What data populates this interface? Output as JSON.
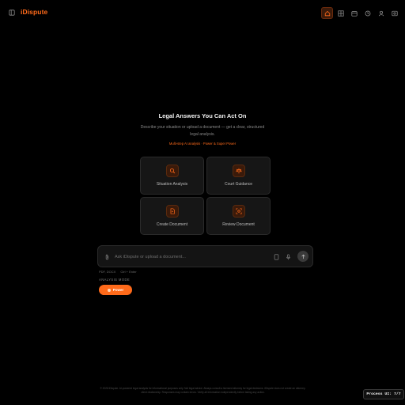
{
  "app": {
    "brand": "iDispute"
  },
  "nav": {
    "items": [
      "home-icon",
      "grid-icon",
      "calendar-icon",
      "clock-icon",
      "user-icon",
      "settings-icon"
    ],
    "active": "home-icon"
  },
  "hero": {
    "title": "Legal Answers You Can Act On",
    "subtitle": "Describe your situation or upload a document — get a clear, structured legal analysis.",
    "tagline": "Multi-step AI analysis · Power & Super Power"
  },
  "cards": [
    {
      "label": "Situation Analysis",
      "icon": "search-icon"
    },
    {
      "label": "Court Guidance",
      "icon": "scales-icon"
    },
    {
      "label": "Create Document",
      "icon": "document-icon"
    },
    {
      "label": "Review Document",
      "icon": "scan-icon"
    }
  ],
  "input": {
    "placeholder": "Ask iDispute or upload a document..."
  },
  "meta": {
    "files": "PDF, DOCX",
    "hint": "Ctrl + Enter"
  },
  "mode": {
    "label": "ANALYSIS MODE",
    "selected": "Power"
  },
  "footer": {
    "text": "© 2026 iDispute. AI-powered legal analysis for informational purposes only. Not legal advice. Always consult a licensed attorney for legal decisions. iDispute does not create an attorney-client relationship. Responses may contain errors. Verify all information independently before taking any action."
  },
  "status": {
    "process": "Process UI: 7/7"
  },
  "colors": {
    "accent": "#ff6a1a",
    "background": "#000000"
  }
}
